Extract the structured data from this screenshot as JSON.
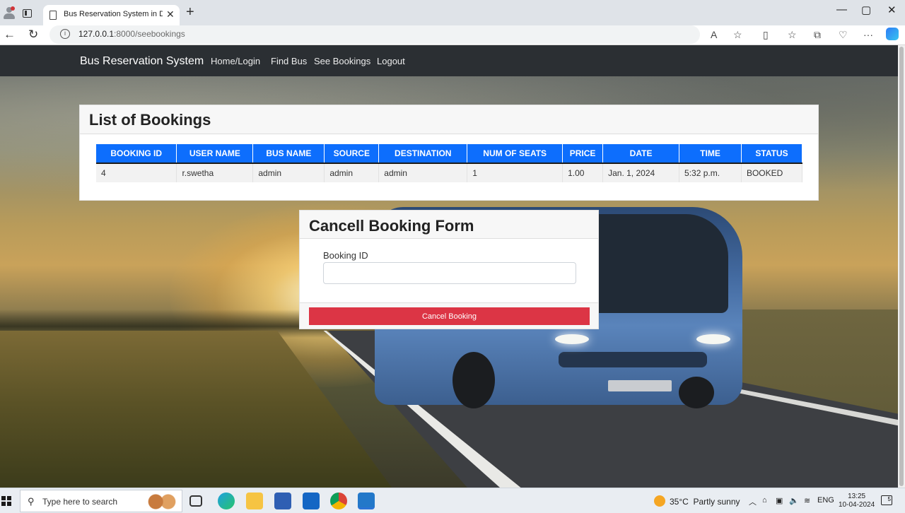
{
  "browser": {
    "tab_title": "Bus Reservation System in Djang",
    "url_host": "127.0.0.1",
    "url_path": ":8000/seebookings"
  },
  "nav": {
    "brand": "Bus Reservation System",
    "links": [
      "Home/Login",
      "Find Bus",
      "See Bookings",
      "Logout"
    ]
  },
  "bookings": {
    "title": "List of Bookings",
    "columns": [
      "BOOKING ID",
      "USER NAME",
      "BUS NAME",
      "SOURCE",
      "DESTINATION",
      "NUM OF SEATS",
      "PRICE",
      "DATE",
      "TIME",
      "STATUS"
    ],
    "rows": [
      [
        "4",
        "r.swetha",
        "admin",
        "admin",
        "admin",
        "1",
        "1.00",
        "Jan. 1, 2024",
        "5:32 p.m.",
        "BOOKED"
      ]
    ],
    "header_color": "#0d6efd"
  },
  "cancel_form": {
    "title": "Cancell Booking Form",
    "label": "Booking ID",
    "value": "",
    "button": "Cancel Booking",
    "button_color": "#dc3545"
  },
  "taskbar": {
    "search_placeholder": "Type here to search",
    "weather_temp": "35°C",
    "weather_text": "Partly sunny",
    "lang": "ENG",
    "time": "13:25",
    "date": "10-04-2024",
    "notification_count": "5"
  }
}
